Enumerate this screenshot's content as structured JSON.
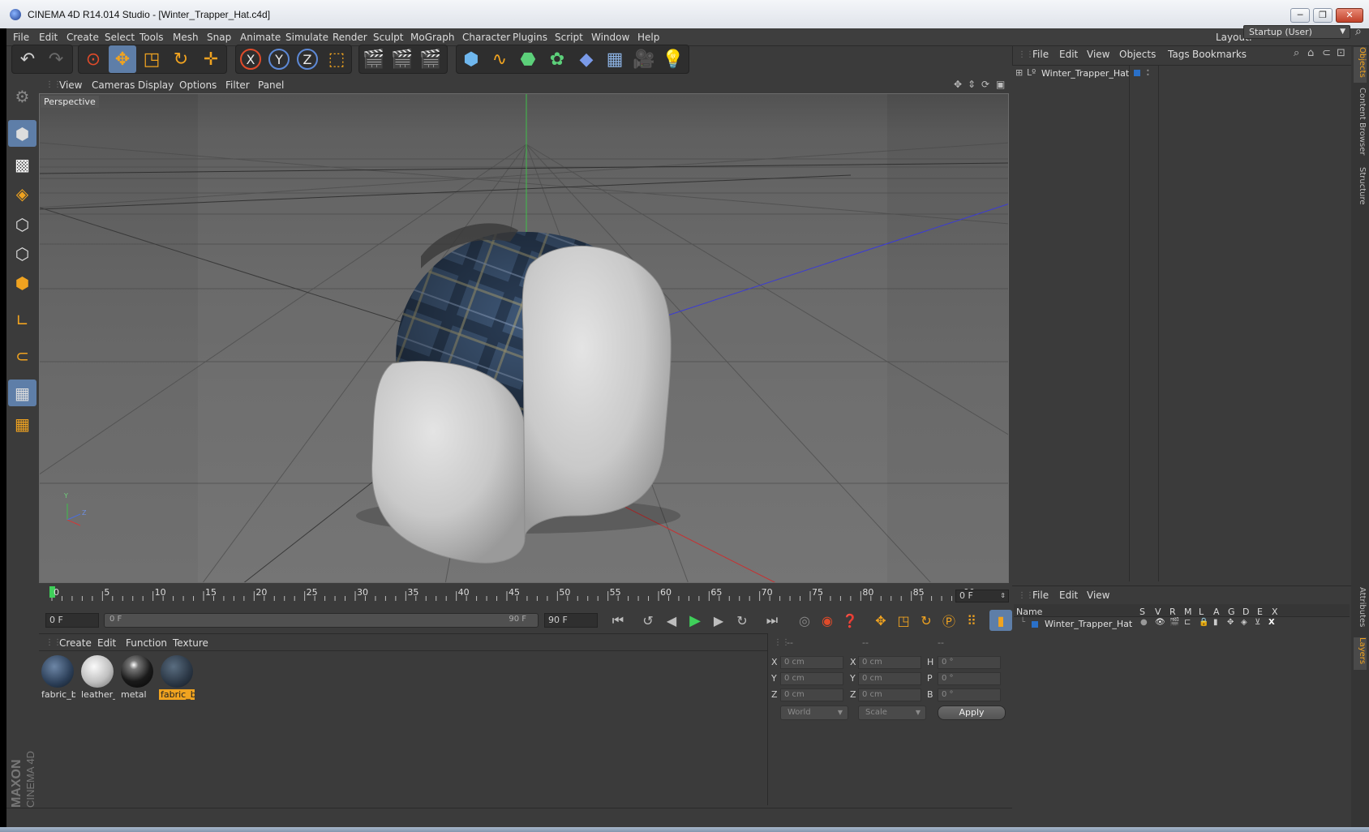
{
  "window": {
    "title": "CINEMA 4D R14.014 Studio - [Winter_Trapper_Hat.c4d]",
    "buttons": {
      "minimize": "─",
      "restore": "❐",
      "close": "✕"
    }
  },
  "menubar": {
    "items": [
      "File",
      "Edit",
      "Create",
      "Select",
      "Tools",
      "Mesh",
      "Snap",
      "Animate",
      "Simulate",
      "Render",
      "Sculpt",
      "MoGraph",
      "Character",
      "Plugins",
      "Script",
      "Window",
      "Help"
    ],
    "layout_label": "Layout:",
    "layout_value": "Startup (User)"
  },
  "toolbar": {
    "icons": [
      "undo-icon",
      "redo-icon",
      "live-select-icon",
      "move-icon",
      "scale-icon",
      "rotate-icon",
      "last-tool-icon",
      "x-axis-icon",
      "y-axis-icon",
      "z-axis-icon",
      "coordinate-system-icon",
      "render-view-icon",
      "render-picture-viewer-icon",
      "edit-render-settings-icon",
      "cube-icon",
      "spline-pen-icon",
      "subdivision-icon",
      "cloner-icon",
      "deformer-icon",
      "floor-icon",
      "camera-icon",
      "light-icon"
    ],
    "axis_x": "X",
    "axis_y": "Y",
    "axis_z": "Z"
  },
  "viewport": {
    "menu": [
      "View",
      "Cameras",
      "Display",
      "Options",
      "Filter",
      "Panel"
    ],
    "label": "Perspective",
    "axis_y": "Y",
    "axis_z": "Z"
  },
  "timeline": {
    "ticks": [
      "0",
      "5",
      "10",
      "15",
      "20",
      "25",
      "30",
      "35",
      "40",
      "45",
      "50",
      "55",
      "60",
      "65",
      "70",
      "75",
      "80",
      "85",
      "90"
    ],
    "current_frame": "0 F",
    "start_field": "0 F",
    "range_start": "0 F",
    "range_end": "90 F",
    "end_field": "90 F"
  },
  "materials": {
    "menu": [
      "Create",
      "Edit",
      "Function",
      "Texture"
    ],
    "items": [
      {
        "label": "fabric_b",
        "selected": false
      },
      {
        "label": "leather_",
        "selected": false
      },
      {
        "label": "metal",
        "selected": false
      },
      {
        "label": "fabric_b",
        "selected": true
      }
    ]
  },
  "coordinates": {
    "col_headers": [
      "--",
      "--",
      "--"
    ],
    "rows": [
      {
        "a": "X",
        "a_val": "0 cm",
        "b": "X",
        "b_val": "0 cm",
        "c": "H",
        "c_val": "0 °"
      },
      {
        "a": "Y",
        "a_val": "0 cm",
        "b": "Y",
        "b_val": "0 cm",
        "c": "P",
        "c_val": "0 °"
      },
      {
        "a": "Z",
        "a_val": "0 cm",
        "b": "Z",
        "b_val": "0 cm",
        "c": "B",
        "c_val": "0 °"
      }
    ],
    "mode": "World",
    "scale": "Scale",
    "apply": "Apply"
  },
  "objects": {
    "menu": [
      "File",
      "Edit",
      "View",
      "Objects",
      "Tags",
      "Bookmarks"
    ],
    "items": [
      {
        "name": "Winter_Trapper_Hat"
      }
    ]
  },
  "layers": {
    "menu": [
      "File",
      "Edit",
      "View"
    ],
    "columns": [
      "Name",
      "S",
      "V",
      "R",
      "M",
      "L",
      "A",
      "G",
      "D",
      "E",
      "X"
    ],
    "items": [
      {
        "name": "Winter_Trapper_Hat"
      }
    ]
  },
  "side_tabs": [
    "Objects",
    "Content Browser",
    "Structure",
    "Attributes",
    "Layers"
  ],
  "logo": {
    "brand": "MAXON",
    "product": "CINEMA 4D"
  }
}
